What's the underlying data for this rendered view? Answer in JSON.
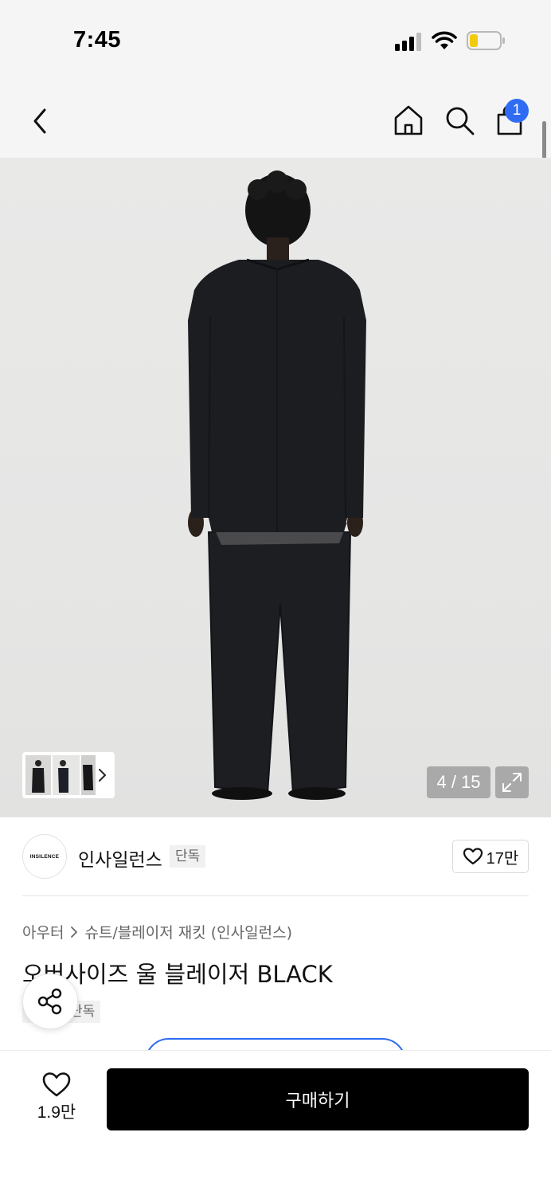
{
  "status_bar": {
    "time": "7:45"
  },
  "header": {
    "cart_count": "1"
  },
  "gallery": {
    "counter": "4 / 15"
  },
  "brand": {
    "logo_text": "INSILENCE",
    "name": "인사일런스",
    "tag": "단독",
    "like_count": "17만"
  },
  "product": {
    "breadcrumb": [
      "아우터",
      "슈트/블레이저 재킷 (인사일런스)"
    ],
    "title": "오버사이즈 울 블레이저 BLACK",
    "tag": "단독"
  },
  "bottom_bar": {
    "wish_count": "1.9만",
    "buy_label": "구매하기"
  },
  "colors": {
    "accent_blue": "#2f6cf3",
    "buy_button": "#000000"
  },
  "icons": [
    "back-chevron-icon",
    "home-icon",
    "search-icon",
    "shopping-bag-icon",
    "expand-icon",
    "heart-icon",
    "share-icon",
    "chevron-right-icon"
  ]
}
